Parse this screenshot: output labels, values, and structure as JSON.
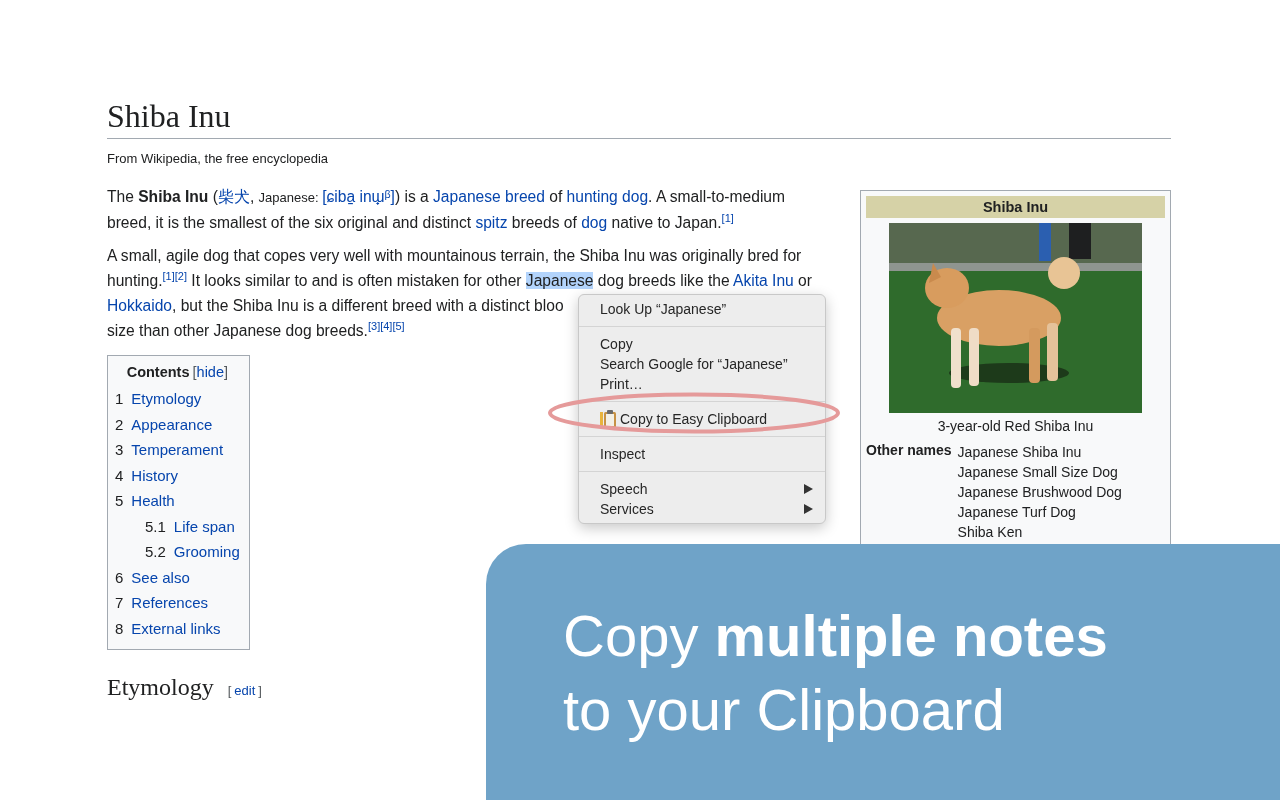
{
  "article": {
    "title": "Shiba Inu",
    "tagline": "From Wikipedia, the free encyclopedia",
    "paragraphs": [
      [
        [
          {
            "kind": "plain",
            "text": "The "
          },
          {
            "kind": "bold",
            "text": "Shiba Inu"
          },
          {
            "kind": "plain",
            "text": " ("
          },
          {
            "kind": "link",
            "text": "柴犬"
          },
          {
            "kind": "plain",
            "text": ", "
          },
          {
            "kind": "small",
            "text": "Japanese: "
          },
          {
            "kind": "link",
            "text": "[ɕiba̠ inɯ̟ᵝ]"
          },
          {
            "kind": "plain",
            "text": ") is a "
          },
          {
            "kind": "link",
            "text": "Japanese breed"
          },
          {
            "kind": "plain",
            "text": " of "
          },
          {
            "kind": "link",
            "text": "hunting dog"
          },
          {
            "kind": "plain",
            "text": ". A small-to-medium"
          }
        ],
        [
          {
            "kind": "plain",
            "text": "breed, it is the smallest of the six original and distinct "
          },
          {
            "kind": "link",
            "text": "spitz"
          },
          {
            "kind": "plain",
            "text": " breeds of "
          },
          {
            "kind": "link",
            "text": "dog"
          },
          {
            "kind": "plain",
            "text": " native to Japan."
          },
          {
            "kind": "ref",
            "text": "[1]"
          }
        ]
      ],
      [
        [
          {
            "kind": "plain",
            "text": "A small, agile dog that copes very well with mountainous terrain, the Shiba Inu was originally bred for"
          }
        ],
        [
          {
            "kind": "plain",
            "text": "hunting."
          },
          {
            "kind": "ref",
            "text": "[1][2]"
          },
          {
            "kind": "plain",
            "text": " It looks similar to and is often mistaken for other "
          },
          {
            "kind": "selected",
            "text": "Japanese"
          },
          {
            "kind": "plain",
            "text": " dog breeds like the "
          },
          {
            "kind": "link",
            "text": "Akita Inu"
          },
          {
            "kind": "plain",
            "text": " or"
          }
        ],
        [
          {
            "kind": "link",
            "text": "Hokkaido"
          },
          {
            "kind": "plain",
            "text": ", but the Shiba Inu is a different breed with a distinct bloo"
          }
        ],
        [
          {
            "kind": "plain",
            "text": "size than other Japanese dog breeds."
          },
          {
            "kind": "ref",
            "text": "[3][4][5]"
          }
        ]
      ]
    ],
    "contents": {
      "title": "Contents",
      "toggle": {
        "open": "[",
        "label": "hide",
        "close": "]"
      },
      "items": [
        {
          "number": "1",
          "label": "Etymology"
        },
        {
          "number": "2",
          "label": "Appearance"
        },
        {
          "number": "3",
          "label": "Temperament"
        },
        {
          "number": "4",
          "label": "History"
        },
        {
          "number": "5",
          "label": "Health",
          "children": [
            {
              "number": "5.1",
              "label": "Life span"
            },
            {
              "number": "5.2",
              "label": "Grooming"
            }
          ]
        },
        {
          "number": "6",
          "label": "See also"
        },
        {
          "number": "7",
          "label": "References"
        },
        {
          "number": "8",
          "label": "External links"
        }
      ]
    },
    "section": {
      "title": "Etymology",
      "edit": {
        "open": "[",
        "label": "edit",
        "close": "]"
      }
    },
    "infobox": {
      "title": "Shiba Inu",
      "caption": "3-year-old Red Shiba Inu",
      "rows": [
        {
          "label": "Other names",
          "values": [
            "Japanese Shiba Inu",
            "Japanese Small Size Dog",
            "Japanese Brushwood Dog",
            "Japanese Turf Dog",
            "Shiba Ken"
          ]
        }
      ]
    }
  },
  "context_menu": {
    "groups": [
      [
        {
          "kind": "plain",
          "label": "Look Up “Japanese”"
        }
      ],
      [
        {
          "kind": "plain",
          "label": "Copy"
        },
        {
          "kind": "plain",
          "label": "Search Google for “Japanese”"
        },
        {
          "kind": "plain",
          "label": "Print…"
        }
      ],
      [
        {
          "kind": "extension",
          "label": "Copy to Easy Clipboard"
        }
      ],
      [
        {
          "kind": "plain",
          "label": "Inspect"
        }
      ],
      [
        {
          "kind": "submenu",
          "label": "Speech"
        },
        {
          "kind": "submenu",
          "label": "Services"
        }
      ]
    ]
  },
  "banner": {
    "lines": [
      "Copy **multiple notes**",
      "to your Clipboard"
    ]
  }
}
